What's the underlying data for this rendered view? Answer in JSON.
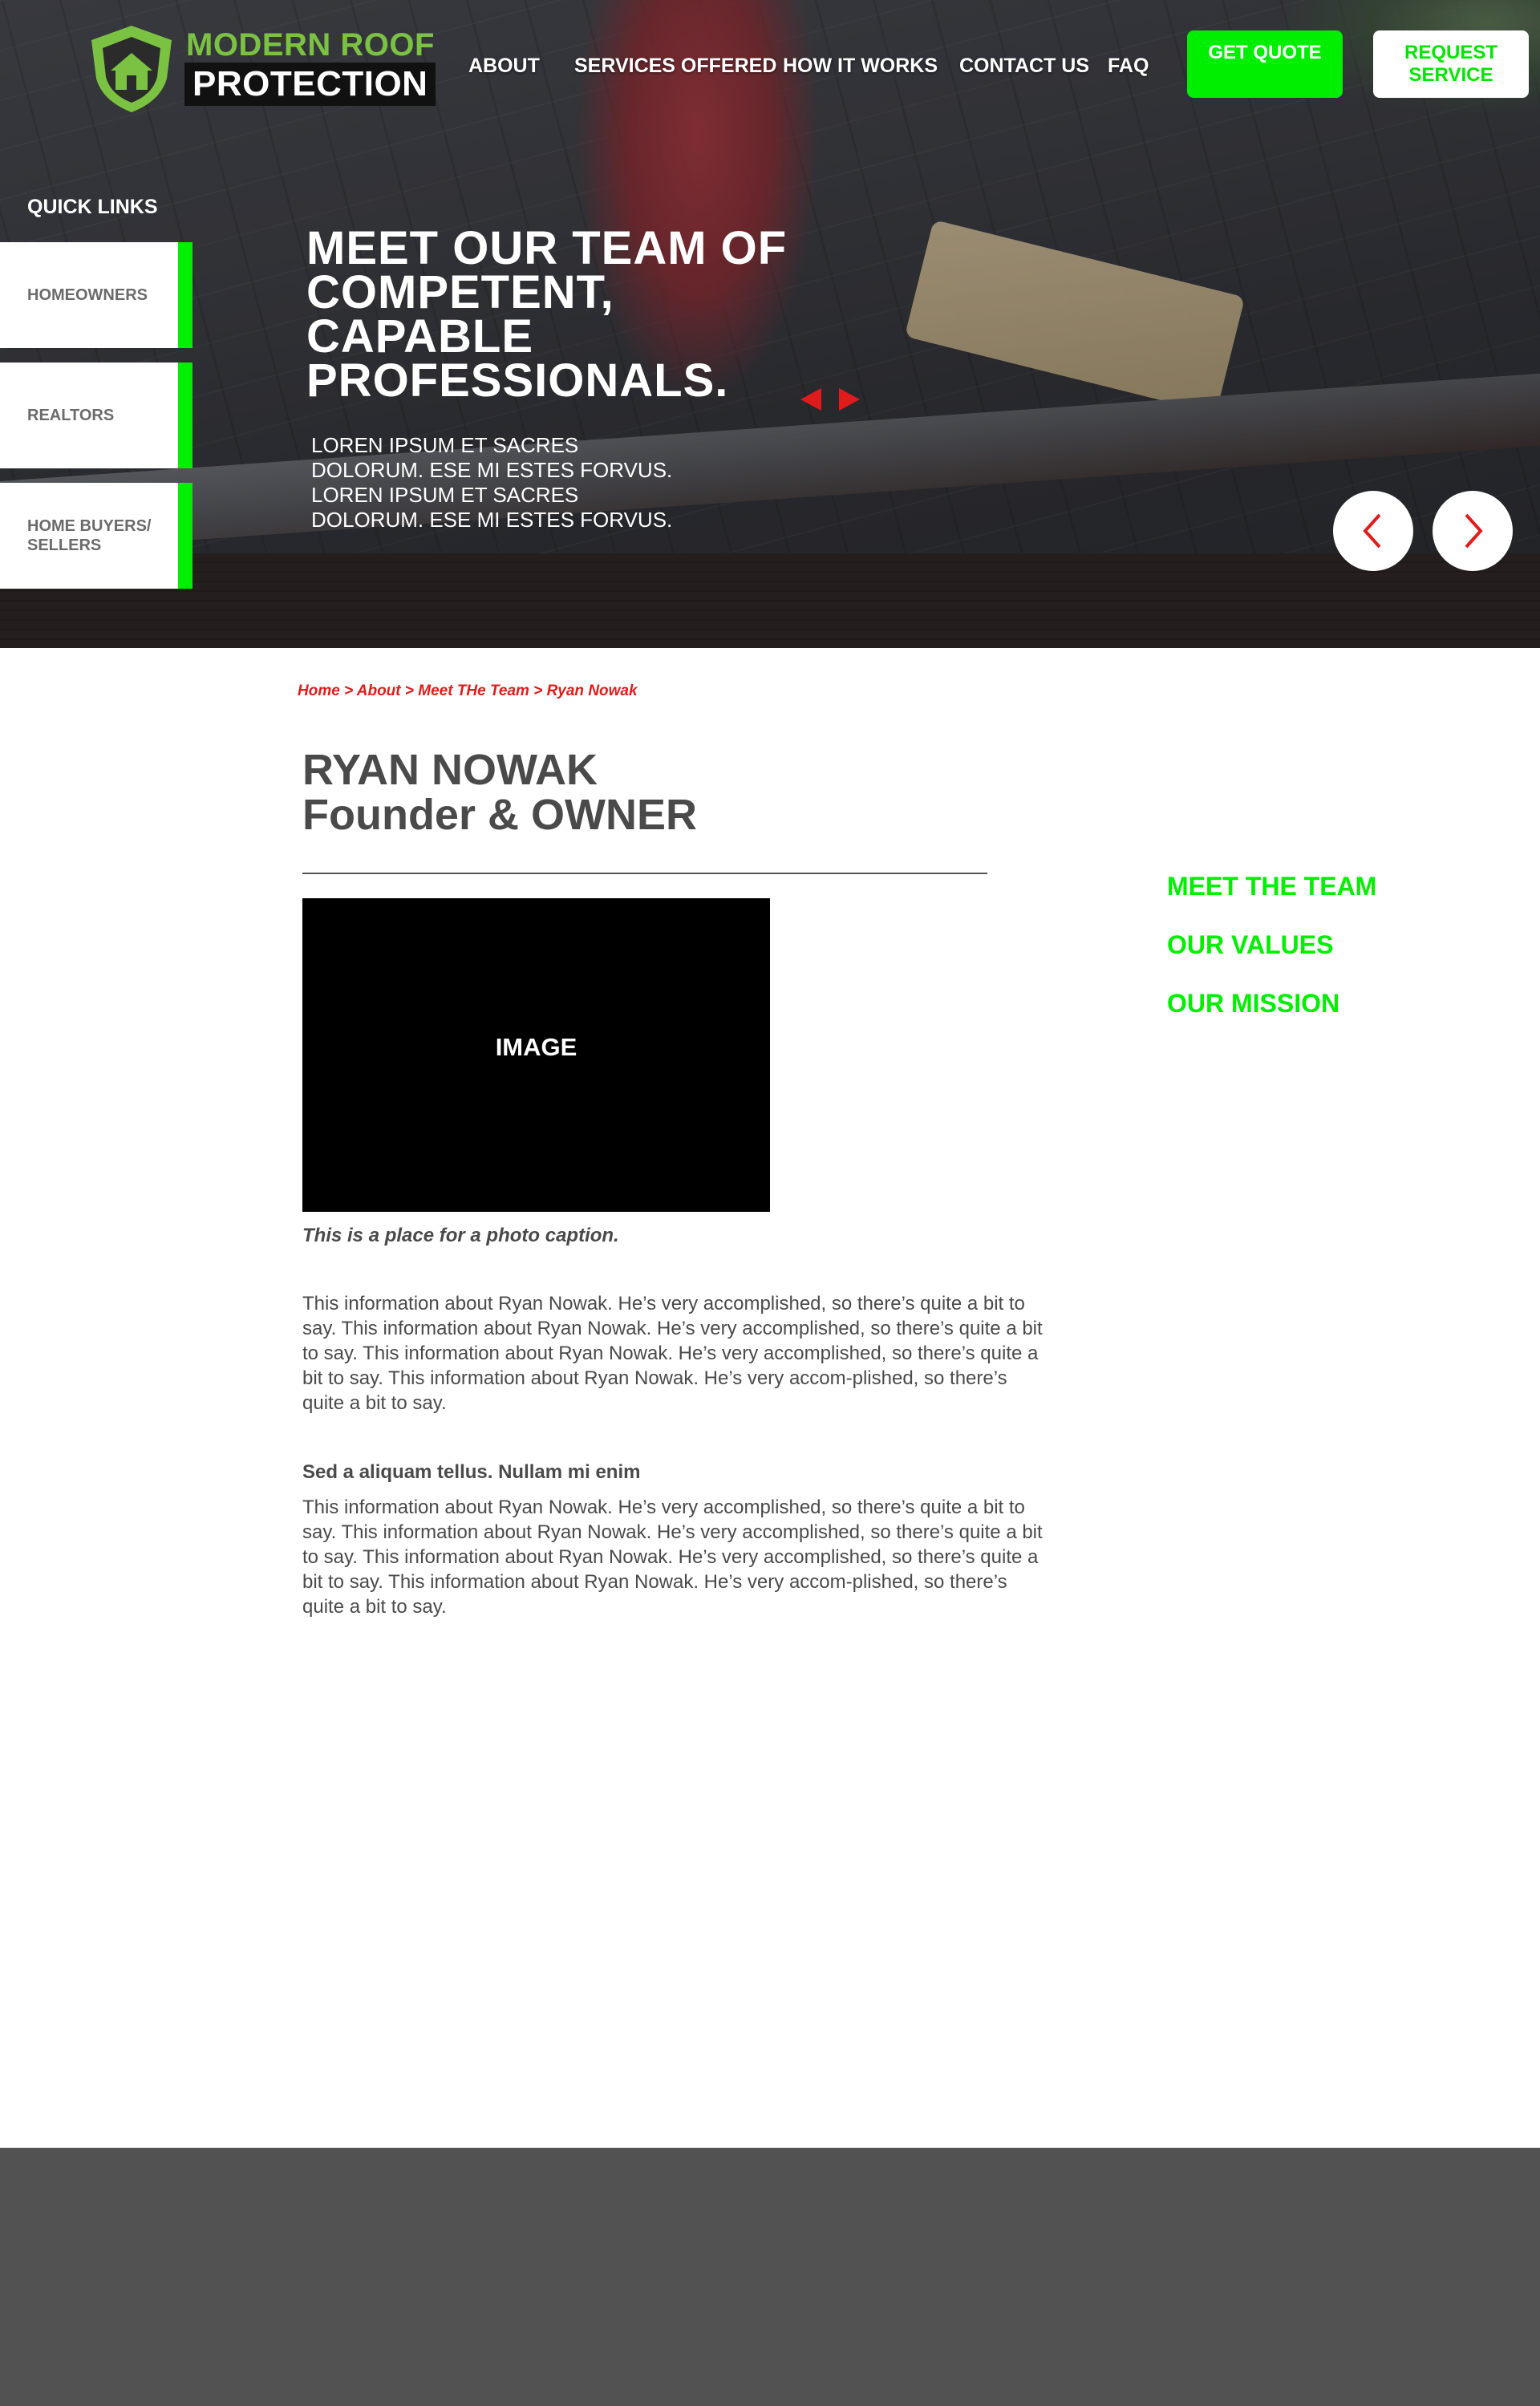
{
  "brand": {
    "line1": "MODERN ROOF",
    "line2": "PROTECTION",
    "colors": {
      "accent_green": "#00ee00",
      "logo_green": "#7cc242",
      "link_red": "#e11b1b",
      "text_gray": "#4a4a4a",
      "footer_gray": "#525252"
    }
  },
  "nav": {
    "items": [
      "ABOUT",
      "SERVICES OFFERED",
      "HOW IT WORKS",
      "CONTACT US",
      "FAQ"
    ]
  },
  "header_buttons": {
    "quote": "GET QUOTE",
    "service": "REQUEST SERVICE"
  },
  "quick_links": {
    "title": "QUICK LINKS",
    "items": [
      "HOMEOWNERS",
      "REALTORS",
      "HOME BUYERS/ SELLERS"
    ]
  },
  "hero": {
    "title": "MEET OUR TEAM OF COMPETENT, CAPABLE PROFESSIONALS.",
    "subtitle": "LOREN IPSUM ET SACRES DOLORUM. ESE MI ESTES FORVUS. LOREN IPSUM ET SACRES DOLORUM. ESE MI ESTES FORVUS.",
    "icons": [
      "arrow-left-icon",
      "arrow-right-icon",
      "chevron-left-icon",
      "chevron-right-icon"
    ]
  },
  "breadcrumb": "Home > About > Meet THe Team > Ryan Nowak",
  "profile": {
    "name": "RYAN NOWAK",
    "role": "Founder & OWNER",
    "image_label": "IMAGE",
    "caption": "This is a place for a photo caption.",
    "para1": "This information about Ryan Nowak. He’s very accomplished, so there’s quite a bit to say. This information about Ryan Nowak. He’s very accomplished, so there’s quite a bit to say. This information about Ryan Nowak. He’s very accomplished, so there’s quite a bit to say. This information about Ryan Nowak. He’s very accom-plished, so there’s quite a bit to say.",
    "subhead": "Sed a aliquam tellus. Nullam mi enim",
    "para2": "This information about Ryan Nowak. He’s very accomplished, so there’s quite a bit to say. This information about Ryan Nowak. He’s very accomplished, so there’s quite a bit to say. This information about Ryan Nowak. He’s very accomplished, so there’s quite a bit to say. This information about Ryan Nowak. He’s very accom-plished, so there’s quite a bit to say."
  },
  "sidebar": {
    "links": [
      "MEET THE TEAM",
      "OUR VALUES",
      "OUR MISSION"
    ]
  }
}
